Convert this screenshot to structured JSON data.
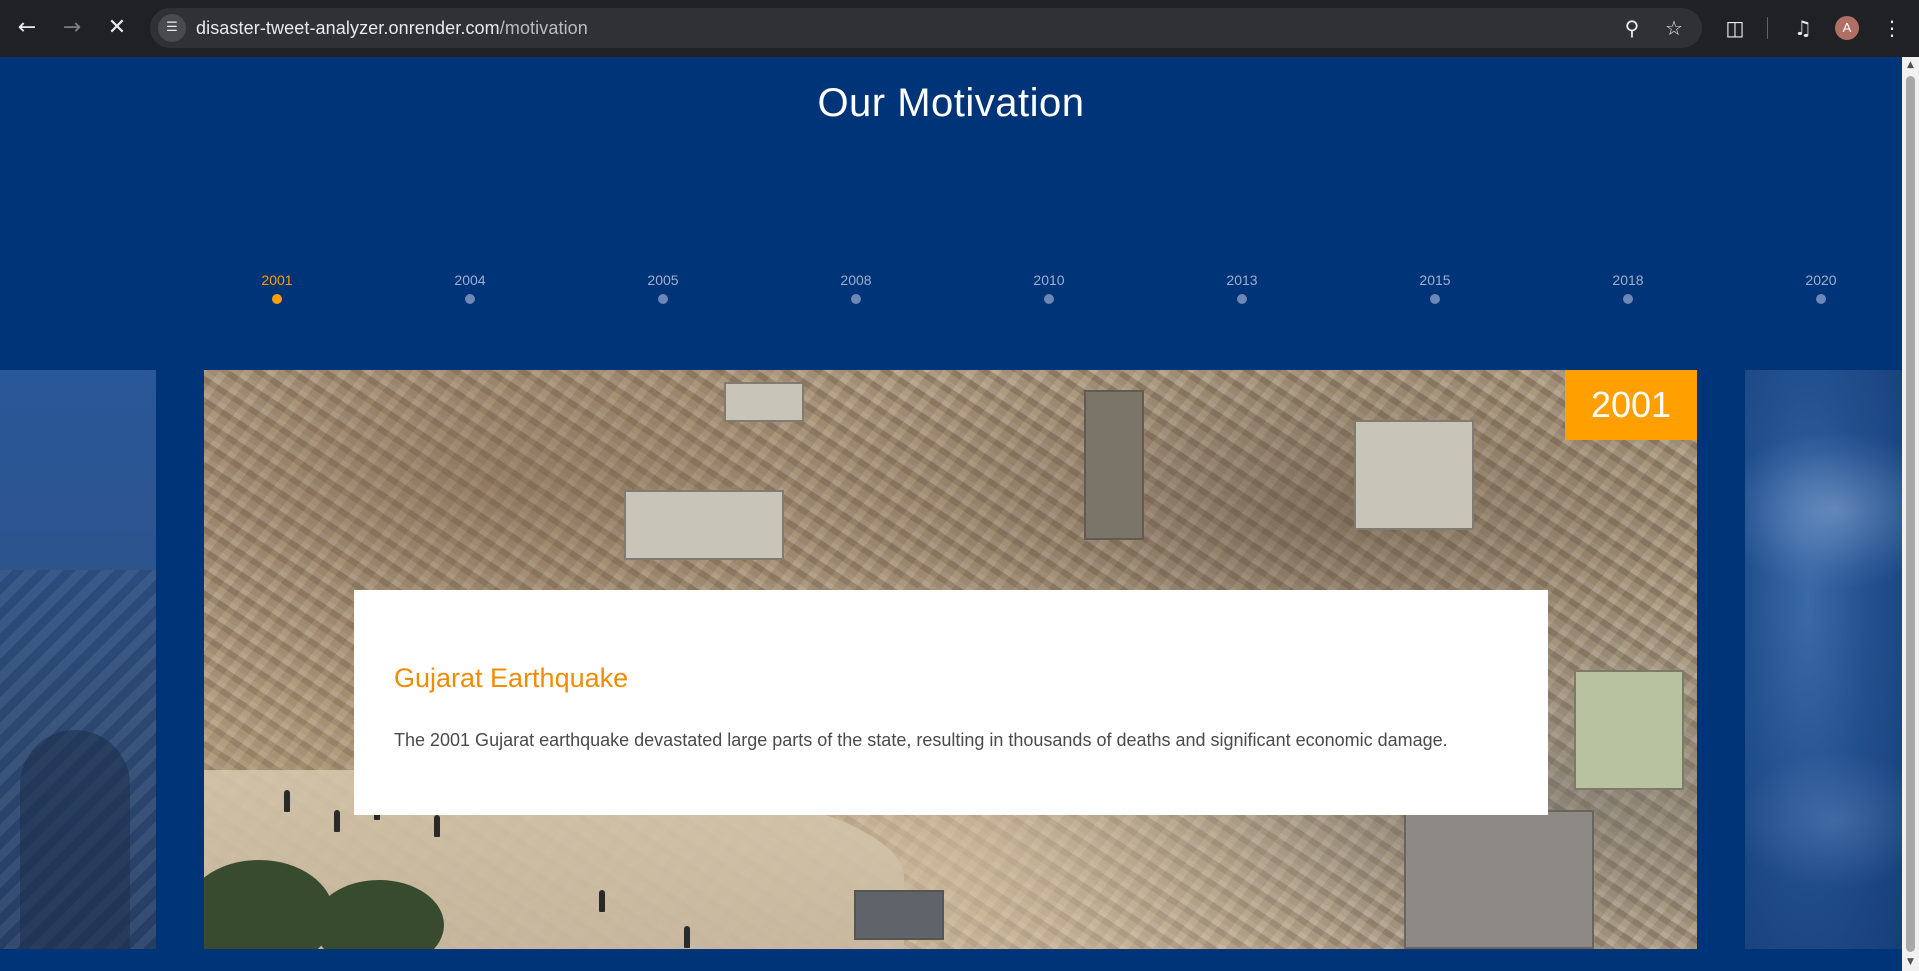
{
  "browser": {
    "url_host": "disaster-tweet-analyzer.onrender.com",
    "url_path": "/motivation",
    "icons": {
      "back": "back-arrow-icon",
      "forward": "forward-arrow-icon",
      "stop": "close-icon",
      "site_info": "tune-icon",
      "zoom": "zoom-icon",
      "bookmark": "star-icon",
      "extensions": "puzzle-icon",
      "media": "media-queue-icon",
      "menu": "kebab-menu-icon"
    },
    "profile_initial": "A",
    "avatar_color": "#b06f64"
  },
  "page": {
    "title": "Our Motivation",
    "background_color": "#003478",
    "accent_color": "#ffa000"
  },
  "timeline": {
    "active_year": "2001",
    "years": [
      "2001",
      "2004",
      "2005",
      "2008",
      "2010",
      "2013",
      "2015",
      "2018",
      "2020"
    ]
  },
  "slide": {
    "year_badge": "2001",
    "title": "Gujarat Earthquake",
    "description": "The 2001 Gujarat earthquake devastated large parts of the state, resulting in thousands of deaths and significant economic damage."
  }
}
